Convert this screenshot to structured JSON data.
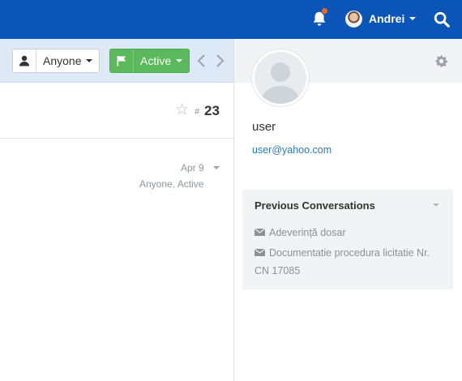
{
  "topbar": {
    "user_name": "Andrei",
    "colors": {
      "background": "#0a55b7",
      "notification_dot": "#f0672a"
    }
  },
  "toolbar": {
    "assignee_label": "Anyone",
    "status_label": "Active",
    "colors": {
      "status_green": "#5cb85c",
      "toolbar_bg": "#dde9f6"
    }
  },
  "conversation": {
    "number_prefix": "#",
    "number": "23",
    "thread": {
      "date": "Apr 9",
      "status": "Anyone, Active"
    }
  },
  "customer": {
    "name": "user",
    "email": "user@yahoo.com"
  },
  "previous_conversations": {
    "title": "Previous Conversations",
    "items": [
      {
        "label": "Adeverință dosar"
      },
      {
        "label": "Documentatie procedura licitatie Nr. CN 17085"
      }
    ]
  },
  "icons": {
    "bell": "bell-icon",
    "search": "search-icon",
    "assignee": "user-icon",
    "status": "flag-icon",
    "prev": "chevron-left-icon",
    "next": "chevron-right-icon",
    "star": "star-icon",
    "gear": "gear-icon",
    "envelope": "envelope-icon"
  }
}
